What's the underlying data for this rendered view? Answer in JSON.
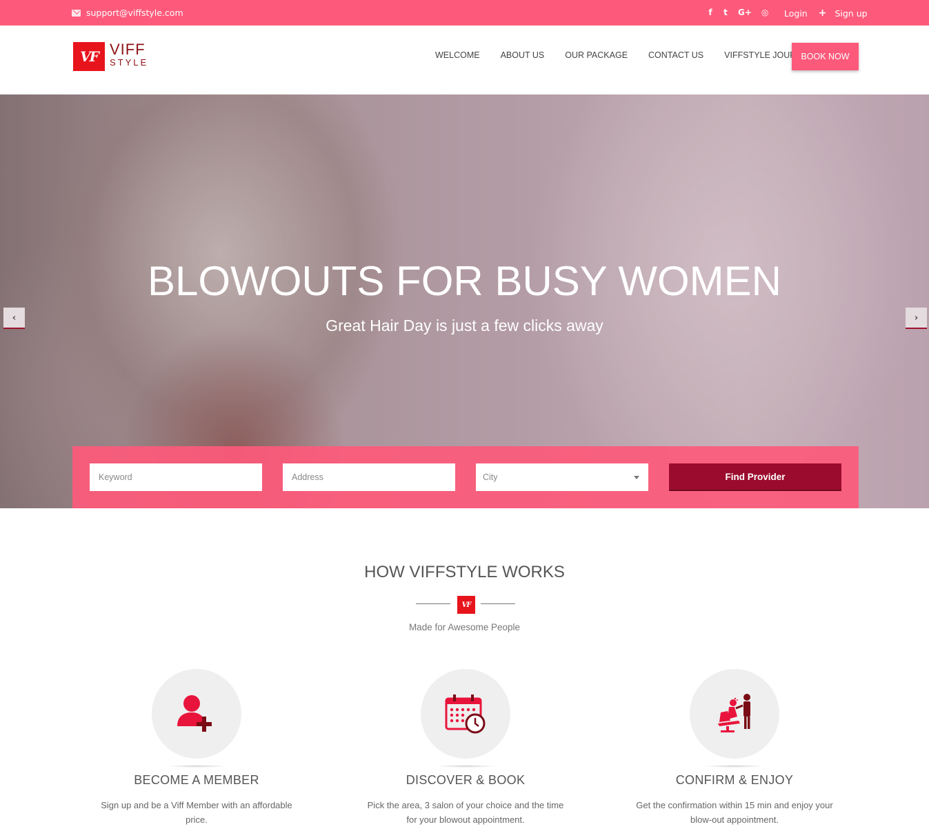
{
  "topbar": {
    "email": "support@viffstyle.com",
    "social": [
      {
        "name": "facebook-icon",
        "glyph": "f"
      },
      {
        "name": "twitter-icon",
        "glyph": "t"
      },
      {
        "name": "google-plus-icon",
        "glyph": "G+"
      },
      {
        "name": "instagram-icon",
        "glyph": "◎"
      }
    ],
    "login": "Login",
    "signup": "Sign up"
  },
  "header": {
    "logo_mark": "VF",
    "logo_word_top": "VIFF",
    "logo_word_bottom": "STYLE",
    "nav": [
      "WELCOME",
      "ABOUT US",
      "OUR PACKAGE",
      "CONTACT US",
      "VIFFSTYLE JOURNAL"
    ],
    "book_now": "BOOK NOW"
  },
  "hero": {
    "title": "BLOWOUTS FOR BUSY WOMEN",
    "subtitle": "Great Hair Day is just a few clicks away",
    "prev_glyph": "‹",
    "next_glyph": "›"
  },
  "search": {
    "keyword_placeholder": "Keyword",
    "address_placeholder": "Address",
    "city_value": "City",
    "find_button": "Find Provider"
  },
  "how": {
    "title": "HOW VIFFSTYLE WORKS",
    "divider_mark": "VF",
    "subtitle": "Made for Awesome People",
    "steps": [
      {
        "title": "BECOME A MEMBER",
        "desc": "Sign up and be a Viff Member with an affordable price.",
        "icon": "add-user-icon"
      },
      {
        "title": "DISCOVER & BOOK",
        "desc": "Pick the area, 3 salon of your choice and the time for your blowout appointment.",
        "icon": "calendar-clock-icon"
      },
      {
        "title": "CONFIRM & ENJOY",
        "desc": "Get the confirmation within 15 min and enjoy your blow-out appointment.",
        "icon": "salon-chair-icon"
      }
    ]
  },
  "colors": {
    "brand_pink": "#fd5a7b",
    "dark_red": "#9b0b2d",
    "logo_red": "#e8141c"
  }
}
